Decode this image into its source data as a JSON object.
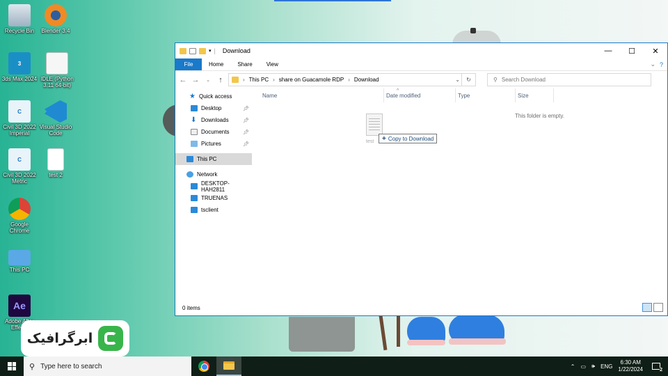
{
  "desktop": {
    "icons": [
      {
        "label": "Recycle Bin",
        "icon": "recycle-bin-icon"
      },
      {
        "label": "Blender 3.4",
        "icon": "blender-icon"
      },
      {
        "label": "3ds Max 2024",
        "icon": "3ds-max-icon",
        "badge": "3"
      },
      {
        "label": "IDLE (Python 3.11 64-bit)",
        "icon": "python-idle-icon"
      },
      {
        "label": "Civil 3D 2022 Imperial",
        "icon": "civil3d-icon",
        "badge": "C"
      },
      {
        "label": "Visual Studio Code",
        "icon": "vscode-icon"
      },
      {
        "label": "Civil 3D 2022 Metric",
        "icon": "civil3d-icon",
        "badge": "C"
      },
      {
        "label": "test 2",
        "icon": "text-file-icon"
      },
      {
        "label": "Google Chrome",
        "icon": "chrome-icon"
      },
      {
        "label": "This PC",
        "icon": "this-pc-icon"
      },
      {
        "label": "Adobe After Effects",
        "icon": "after-effects-icon",
        "badge": "Ae"
      }
    ],
    "logo_text": "ابرگرافیک"
  },
  "explorer": {
    "title": "Download",
    "controls": {
      "minimize": "—",
      "maximize": "☐",
      "close": "✕"
    },
    "ribbon_tabs": [
      "File",
      "Home",
      "Share",
      "View"
    ],
    "address": {
      "crumbs": [
        "This PC",
        "share on Guacamole RDP",
        "Download"
      ]
    },
    "search_placeholder": "Search Download",
    "sidebar": {
      "quick_access": "Quick access",
      "quick_items": [
        "Desktop",
        "Downloads",
        "Documents",
        "Pictures"
      ],
      "this_pc": "This PC",
      "network": "Network",
      "network_items": [
        "DESKTOP-HAH2811",
        "TRUENAS",
        "tsclient"
      ]
    },
    "columns": [
      "Name",
      "Date modified",
      "Type",
      "Size"
    ],
    "empty_message": "This folder is empty.",
    "drag": {
      "file_label": "test",
      "tooltip": "Copy to Download"
    },
    "status": "0 items"
  },
  "taskbar": {
    "search_placeholder": "Type here to search",
    "lang": "ENG",
    "time": "6:30 AM",
    "date": "1/22/2024",
    "notifications": "2"
  },
  "colors": {
    "accent": "#1979ca",
    "taskbar": "#0f1e16",
    "folder": "#f3c64b"
  }
}
